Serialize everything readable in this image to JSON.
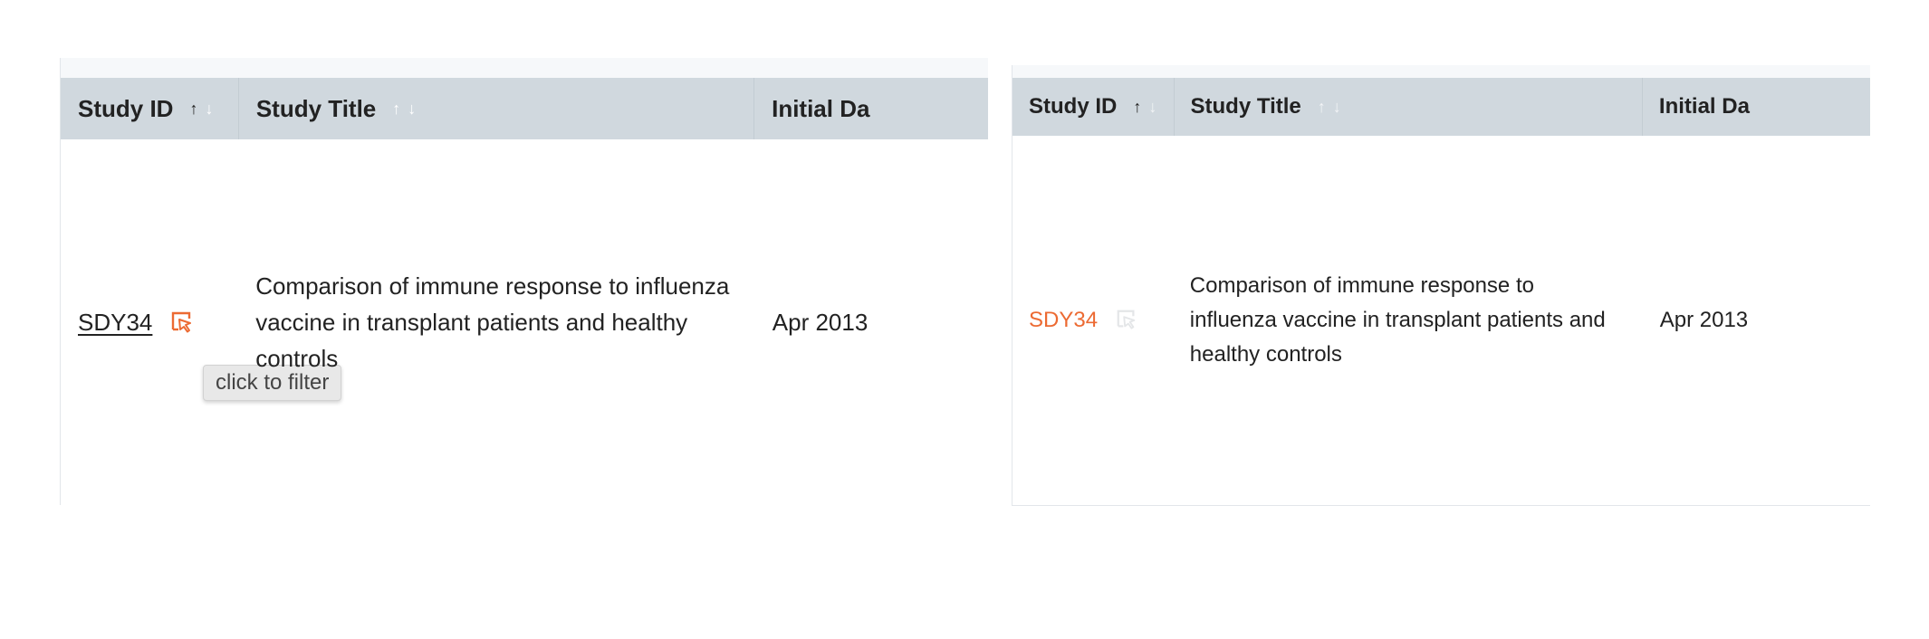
{
  "colors": {
    "header_bg": "#d0d8de",
    "accent_orange": "#ec6a32",
    "text": "#222222",
    "tooltip_bg": "#e8e8e8"
  },
  "left_table": {
    "columns": [
      {
        "label": "Study ID"
      },
      {
        "label": "Study Title"
      },
      {
        "label": "Initial Da"
      }
    ],
    "sort_icons": {
      "up": "↑",
      "down": "↓"
    },
    "row": {
      "study_id": "SDY34",
      "filter_icon": "filter-cursor-icon",
      "title": "Comparison of immune response to influenza vaccine in transplant patients and healthy controls",
      "initial_date": "Apr 2013"
    },
    "tooltip": "click to filter"
  },
  "right_table": {
    "columns": [
      {
        "label": "Study ID"
      },
      {
        "label": "Study Title"
      },
      {
        "label": "Initial Da"
      }
    ],
    "sort_icons": {
      "up": "↑",
      "down": "↓"
    },
    "row": {
      "study_id": "SDY34",
      "filter_icon": "filter-cursor-icon",
      "title": "Comparison of immune response to influenza vaccine in transplant patients and healthy controls",
      "initial_date": "Apr 2013"
    }
  }
}
